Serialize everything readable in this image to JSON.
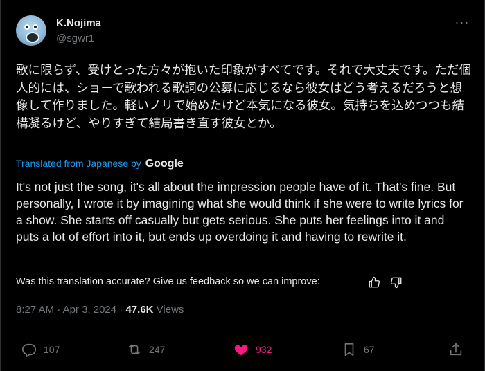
{
  "author": {
    "name": "K.Nojima",
    "handle": "@sgwr1",
    "avatar_icon": "blue-character-avatar",
    "more_icon": "more-horizontal-icon"
  },
  "post": {
    "original_text": "歌に限らず、受けとった方々が抱いた印象がすべてです。それで大丈夫です。ただ個人的には、ショーで歌われる歌詞の公募に応じるなら彼女はどう考えるだろうと想像して作りました。軽いノリで始めたけど本気になる彼女。気持ちを込めつつも結構凝るけど、やりすぎて結局書き直す彼女とか。",
    "translated_label": "Translated from Japanese by",
    "translated_brand": "Google",
    "translated_text": "It's not just the song, it's all about the impression people have of it. That's fine. But personally, I wrote it by imagining what she would think if she were to write lyrics for a show. She starts off casually but gets serious. She puts her feelings into it and puts a lot of effort into it, but ends up overdoing it and having to rewrite it.",
    "feedback_prompt": "Was this translation accurate? Give us feedback so we can improve:",
    "time": "8:27 AM",
    "date": "Apr 3, 2024",
    "separator": "·",
    "views_count": "47.6K",
    "views_label": "Views"
  },
  "actions": {
    "replies": "107",
    "reposts": "247",
    "likes": "932",
    "bookmarks": "67"
  },
  "colors": {
    "background": "#000000",
    "text": "#e7e9ea",
    "secondary": "#71767b",
    "link": "#1d9bf0",
    "like": "#f91880",
    "divider": "#2f3336"
  }
}
